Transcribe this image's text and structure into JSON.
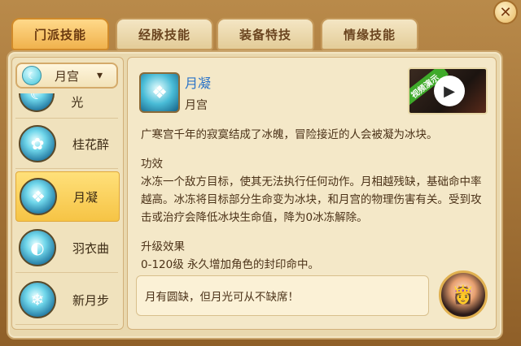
{
  "tabs": [
    {
      "label": "门派技能",
      "active": true
    },
    {
      "label": "经脉技能",
      "active": false
    },
    {
      "label": "装备特技",
      "active": false
    },
    {
      "label": "情缘技能",
      "active": false
    }
  ],
  "close_symbol": "✕",
  "school_dropdown": {
    "selected": "月宫",
    "icon": "crescent-moon-icon"
  },
  "skills": [
    {
      "label": "月影摇光",
      "icon": "moon-shadow-icon"
    },
    {
      "label": "桂花醉",
      "icon": "osmanthus-icon"
    },
    {
      "label": "月凝",
      "icon": "ice-crystal-icon"
    },
    {
      "label": "羽衣曲",
      "icon": "feather-swirl-icon"
    },
    {
      "label": "新月步",
      "icon": "snowflake-icon"
    }
  ],
  "selected_skill": {
    "name": "月凝",
    "school": "月宫",
    "video_ribbon": "视频演示",
    "description": "广寒宫千年的寂寞结成了冰魄，冒险接近的人会被凝为冰块。",
    "effect_heading": "功效",
    "effect_body": "冰冻一个敌方目标，使其无法执行任何动作。月相越残缺，基础命中率越高。冰冻将目标部分生命变为冰块，和月宫的物理伤害有关。受到攻击或治疗会降低冰块生命值，降为0冰冻解除。",
    "upgrade_heading": "升级效果",
    "upgrade_body": "0-120级 永久增加角色的封印命中。"
  },
  "npc_quote": "月有圆缺，但月光可从不缺席！",
  "colors": {
    "accent": "#2a73c8",
    "tab_active": "#f0b24d",
    "panel": "#e9d8ae"
  }
}
